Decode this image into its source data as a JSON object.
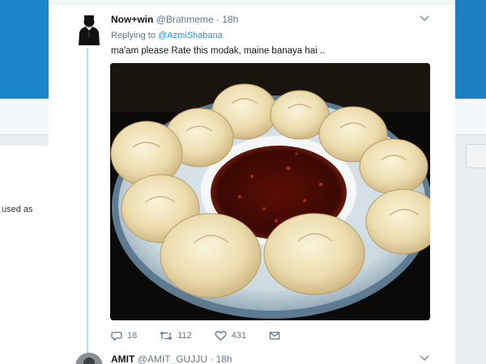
{
  "background": {
    "left_text": "used as"
  },
  "tweet": {
    "display_name": "Now+win",
    "handle": "@Brahmeme",
    "dot": "·",
    "time": "18h",
    "replying_prefix": "Replying to",
    "replying_to": "@AzmiShabana",
    "text": "ma'am please Rate this modak, maine banaya hai ..",
    "photo_subject": "plate of steamed dumplings around a bowl of red chili sauce",
    "actions": {
      "replies": "18",
      "retweets": "112",
      "likes": "431"
    }
  },
  "next_tweet": {
    "display_name": "AMIT",
    "handle": "@AMIT_GUJJU",
    "dot": "·",
    "time": "18h"
  },
  "colors": {
    "brand_blue": "#1b86c9",
    "link": "#1b95e0",
    "muted": "#657786",
    "thread_line": "#b5dcf5"
  },
  "icons": [
    "reply-icon",
    "retweet-icon",
    "like-icon",
    "direct-message-icon",
    "chevron-down-icon"
  ]
}
